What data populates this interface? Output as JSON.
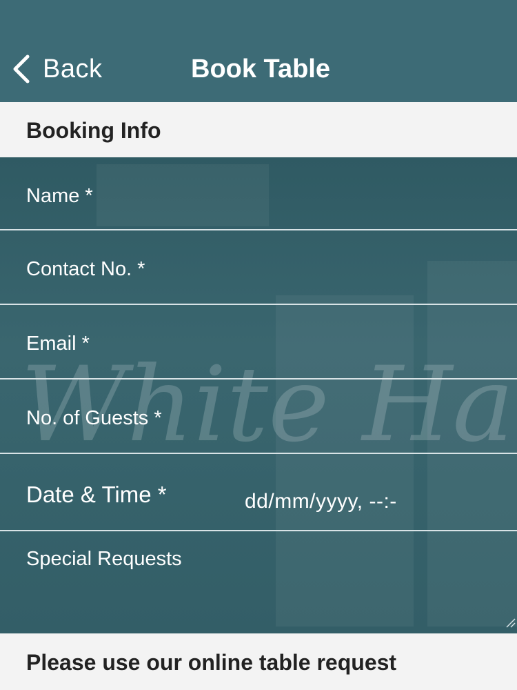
{
  "nav": {
    "back_label": "Back",
    "title": "Book Table",
    "back_icon": "chevron-left-icon"
  },
  "section": {
    "title": "Booking Info"
  },
  "form": {
    "fields": [
      {
        "label": "Name *"
      },
      {
        "label": "Contact No. *"
      },
      {
        "label": "Email *"
      },
      {
        "label": "No. of Guests *"
      },
      {
        "label": "Date & Time *",
        "value": "dd/mm/yyyy, --:-"
      },
      {
        "label": "Special Requests"
      }
    ],
    "background_text": "White Hart"
  },
  "footer": {
    "text": "Please use our online table request"
  },
  "colors": {
    "navbar": "#3d6b76",
    "form_background": "#36626b",
    "section_background": "#f3f3f3",
    "divider": "#d8e3e6"
  }
}
